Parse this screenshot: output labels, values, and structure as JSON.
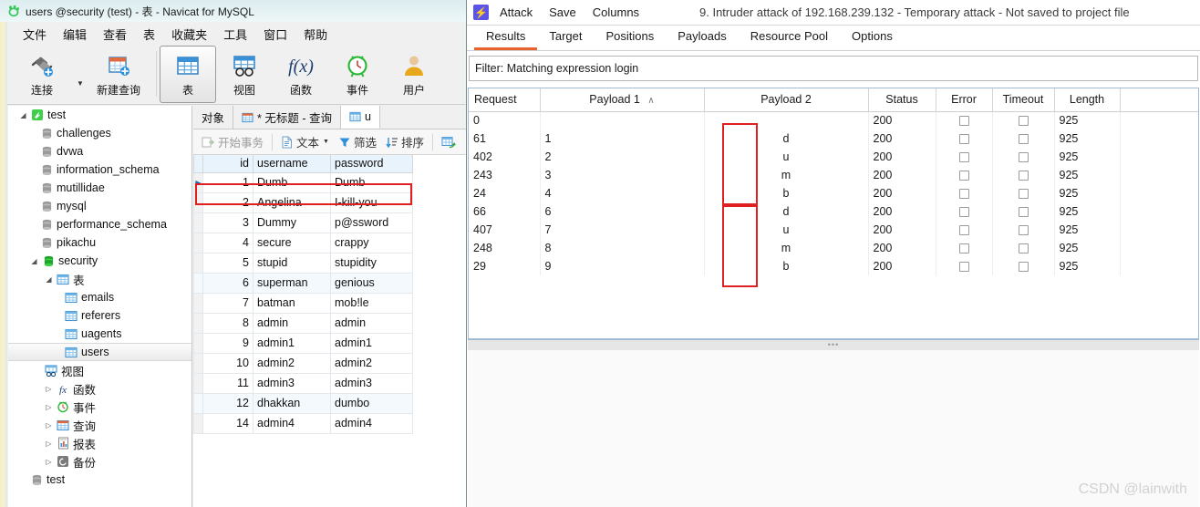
{
  "navicat": {
    "title": "users @security (test) - 表 - Navicat for MySQL",
    "logo_icon": "navicat-paw-icon",
    "menu": [
      {
        "label": "文件"
      },
      {
        "label": "编辑"
      },
      {
        "label": "查看"
      },
      {
        "label": "表"
      },
      {
        "label": "收藏夹"
      },
      {
        "label": "工具"
      },
      {
        "label": "窗口"
      },
      {
        "label": "帮助"
      }
    ],
    "toolbar": [
      {
        "label": "连接",
        "icon": "connection-plug-icon",
        "selected": false,
        "has_dropdown": true
      },
      {
        "label": "新建查询",
        "icon": "new-query-icon",
        "selected": false
      },
      {
        "label": "表",
        "icon": "table-grid-icon",
        "selected": true
      },
      {
        "label": "视图",
        "icon": "view-icon",
        "selected": false
      },
      {
        "label": "函数",
        "icon": "function-fx-icon",
        "selected": false
      },
      {
        "label": "事件",
        "icon": "event-clock-icon",
        "selected": false
      },
      {
        "label": "用户",
        "icon": "user-person-icon",
        "selected": false
      }
    ],
    "sidebar": [
      {
        "label": "test",
        "icon": "connection-icon",
        "depth": 0,
        "twisty": "open",
        "selected": false
      },
      {
        "label": "challenges",
        "icon": "database-icon",
        "depth": 1,
        "twisty": "",
        "selected": false
      },
      {
        "label": "dvwa",
        "icon": "database-icon",
        "depth": 1,
        "twisty": "",
        "selected": false
      },
      {
        "label": "information_schema",
        "icon": "database-icon",
        "depth": 1,
        "twisty": "",
        "selected": false
      },
      {
        "label": "mutillidae",
        "icon": "database-icon",
        "depth": 1,
        "twisty": "",
        "selected": false
      },
      {
        "label": "mysql",
        "icon": "database-icon",
        "depth": 1,
        "twisty": "",
        "selected": false
      },
      {
        "label": "performance_schema",
        "icon": "database-icon",
        "depth": 1,
        "twisty": "",
        "selected": false
      },
      {
        "label": "pikachu",
        "icon": "database-icon",
        "depth": 1,
        "twisty": "",
        "selected": false
      },
      {
        "label": "security",
        "icon": "database-open-icon",
        "depth": 1,
        "twisty": "open",
        "selected": false
      },
      {
        "label": "表",
        "icon": "table-folder-icon",
        "depth": 2,
        "twisty": "open",
        "selected": false
      },
      {
        "label": "emails",
        "icon": "table-icon",
        "depth": 3,
        "twisty": "",
        "selected": false
      },
      {
        "label": "referers",
        "icon": "table-icon",
        "depth": 3,
        "twisty": "",
        "selected": false
      },
      {
        "label": "uagents",
        "icon": "table-icon",
        "depth": 3,
        "twisty": "",
        "selected": false
      },
      {
        "label": "users",
        "icon": "table-icon",
        "depth": 3,
        "twisty": "",
        "selected": true
      },
      {
        "label": "视图",
        "icon": "view-folder-icon",
        "depth": 2,
        "twisty": "",
        "selected": false
      },
      {
        "label": "函数",
        "icon": "function-fx-icon",
        "depth": 2,
        "twisty": "closed",
        "selected": false
      },
      {
        "label": "事件",
        "icon": "event-clock-icon",
        "depth": 2,
        "twisty": "closed",
        "selected": false
      },
      {
        "label": "查询",
        "icon": "query-icon",
        "depth": 2,
        "twisty": "closed",
        "selected": false
      },
      {
        "label": "报表",
        "icon": "report-icon",
        "depth": 2,
        "twisty": "closed",
        "selected": false
      },
      {
        "label": "备份",
        "icon": "backup-icon",
        "depth": 2,
        "twisty": "closed",
        "selected": false
      },
      {
        "label": "test",
        "icon": "database-icon",
        "depth": 1,
        "twisty": "",
        "selected": false
      }
    ],
    "grid_tabs": [
      {
        "label": "对象",
        "icon": "",
        "active": false
      },
      {
        "label": "* 无标题 - 查询",
        "icon": "query-icon",
        "active": false
      },
      {
        "label": "u",
        "icon": "table-icon",
        "active": true
      }
    ],
    "grid_toolbar": [
      {
        "label": "开始事务",
        "icon": "transaction-icon",
        "dim": true
      },
      {
        "label": "文本",
        "icon": "text-icon",
        "dim": false,
        "has_dropdown": true
      },
      {
        "label": "筛选",
        "icon": "filter-funnel-icon",
        "dim": false
      },
      {
        "label": "排序",
        "icon": "sort-icon",
        "dim": false
      },
      {
        "label": "",
        "icon": "import-wizard-icon",
        "dim": false
      }
    ],
    "table": {
      "columns": [
        "id",
        "username",
        "password"
      ],
      "rows": [
        {
          "id": "1",
          "username": "Dumb",
          "password": "Dumb",
          "current": true,
          "highlighted": true
        },
        {
          "id": "2",
          "username": "Angelina",
          "password": "I-kill-you",
          "current": false,
          "highlighted": false
        },
        {
          "id": "3",
          "username": "Dummy",
          "password": "p@ssword",
          "current": false,
          "highlighted": false
        },
        {
          "id": "4",
          "username": "secure",
          "password": "crappy",
          "current": false,
          "highlighted": false
        },
        {
          "id": "5",
          "username": "stupid",
          "password": "stupidity",
          "current": false,
          "highlighted": false
        },
        {
          "id": "6",
          "username": "superman",
          "password": "genious",
          "current": false,
          "highlighted": false,
          "alt": true
        },
        {
          "id": "7",
          "username": "batman",
          "password": "mob!le",
          "current": false,
          "highlighted": false
        },
        {
          "id": "8",
          "username": "admin",
          "password": "admin",
          "current": false,
          "highlighted": false
        },
        {
          "id": "9",
          "username": "admin1",
          "password": "admin1",
          "current": false,
          "highlighted": false
        },
        {
          "id": "10",
          "username": "admin2",
          "password": "admin2",
          "current": false,
          "highlighted": false
        },
        {
          "id": "11",
          "username": "admin3",
          "password": "admin3",
          "current": false,
          "highlighted": false
        },
        {
          "id": "12",
          "username": "dhakkan",
          "password": "dumbo",
          "current": false,
          "highlighted": false,
          "alt": true
        },
        {
          "id": "14",
          "username": "admin4",
          "password": "admin4",
          "current": false,
          "highlighted": false
        }
      ]
    }
  },
  "burp": {
    "logo_icon": "burp-intruder-bolt-icon",
    "menu": [
      {
        "label": "Attack"
      },
      {
        "label": "Save"
      },
      {
        "label": "Columns"
      }
    ],
    "attack_title": "9. Intruder attack of 192.168.239.132 - Temporary attack - Not saved to project file",
    "tabs": [
      {
        "label": "Results",
        "active": true
      },
      {
        "label": "Target",
        "active": false
      },
      {
        "label": "Positions",
        "active": false
      },
      {
        "label": "Payloads",
        "active": false
      },
      {
        "label": "Resource Pool",
        "active": false
      },
      {
        "label": "Options",
        "active": false
      }
    ],
    "filter": "Filter: Matching expression login",
    "results": {
      "columns": [
        {
          "label": "Request",
          "sorted": false
        },
        {
          "label": "Payload 1",
          "sorted": true,
          "sort_glyph": "∧"
        },
        {
          "label": "Payload 2",
          "sorted": false
        },
        {
          "label": "Status",
          "sorted": false
        },
        {
          "label": "Error",
          "sorted": false
        },
        {
          "label": "Timeout",
          "sorted": false
        },
        {
          "label": "Length",
          "sorted": false
        }
      ],
      "rows": [
        {
          "request": "0",
          "payload1": "",
          "payload2": "",
          "status": "200",
          "error": false,
          "timeout": false,
          "length": "925"
        },
        {
          "request": "61",
          "payload1": "1",
          "payload2": "d",
          "status": "200",
          "error": false,
          "timeout": false,
          "length": "925"
        },
        {
          "request": "402",
          "payload1": "2",
          "payload2": "u",
          "status": "200",
          "error": false,
          "timeout": false,
          "length": "925"
        },
        {
          "request": "243",
          "payload1": "3",
          "payload2": "m",
          "status": "200",
          "error": false,
          "timeout": false,
          "length": "925"
        },
        {
          "request": "24",
          "payload1": "4",
          "payload2": "b",
          "status": "200",
          "error": false,
          "timeout": false,
          "length": "925"
        },
        {
          "request": "66",
          "payload1": "6",
          "payload2": "d",
          "status": "200",
          "error": false,
          "timeout": false,
          "length": "925"
        },
        {
          "request": "407",
          "payload1": "7",
          "payload2": "u",
          "status": "200",
          "error": false,
          "timeout": false,
          "length": "925"
        },
        {
          "request": "248",
          "payload1": "8",
          "payload2": "m",
          "status": "200",
          "error": false,
          "timeout": false,
          "length": "925"
        },
        {
          "request": "29",
          "payload1": "9",
          "payload2": "b",
          "status": "200",
          "error": false,
          "timeout": false,
          "length": "925"
        }
      ]
    },
    "splitter_icon": "splitter-dots-icon"
  },
  "watermark": "CSDN @lainwith",
  "colors": {
    "burp_accent": "#e8622c",
    "burp_logo": "#5b54e8",
    "highlight_box": "#e02020",
    "navicat_title_bg": "#e4f1f3",
    "grid_header_bg": "#e9f3fb"
  }
}
